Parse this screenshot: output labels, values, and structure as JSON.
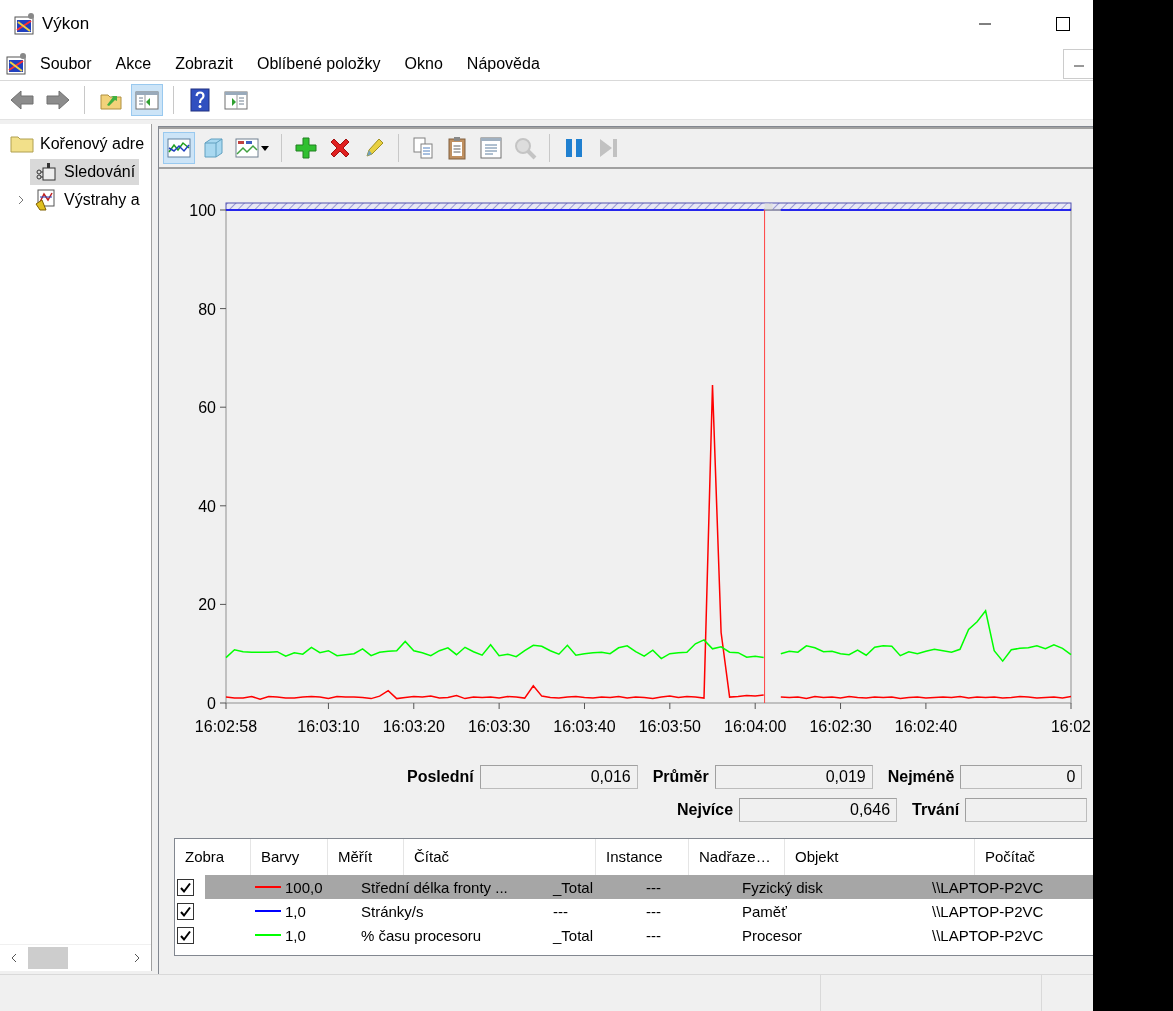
{
  "window": {
    "title": "Výkon"
  },
  "menu": [
    "Soubor",
    "Akce",
    "Zobrazit",
    "Oblíbené položky",
    "Okno",
    "Nápověda"
  ],
  "toolbar": [
    {
      "kind": "back",
      "pressed": false
    },
    {
      "kind": "forward",
      "pressed": false
    },
    {
      "kind": "separator"
    },
    {
      "kind": "up",
      "pressed": false
    },
    {
      "kind": "tree",
      "pressed": true
    },
    {
      "kind": "separator"
    },
    {
      "kind": "help",
      "pressed": false
    },
    {
      "kind": "pane",
      "pressed": false
    }
  ],
  "tree": [
    {
      "label": "Kořenový adre",
      "kind": "folder",
      "selected": false,
      "children": [
        {
          "label": "Sledování",
          "kind": "monitor",
          "selected": true
        },
        {
          "label": "Výstrahy a",
          "kind": "alerts",
          "selected": false,
          "expanded": false
        }
      ]
    }
  ],
  "chart_toolbar": [
    {
      "kind": "graph",
      "pressed": true,
      "disabled": false
    },
    {
      "kind": "histogram",
      "pressed": false,
      "disabled": false
    },
    {
      "kind": "report",
      "pressed": false,
      "disabled": false
    },
    {
      "kind": "separator"
    },
    {
      "kind": "add",
      "pressed": false,
      "disabled": false
    },
    {
      "kind": "delete",
      "pressed": false,
      "disabled": false
    },
    {
      "kind": "highlight",
      "pressed": false,
      "disabled": false
    },
    {
      "kind": "separator"
    },
    {
      "kind": "copy",
      "pressed": false,
      "disabled": false
    },
    {
      "kind": "paste",
      "pressed": false,
      "disabled": false
    },
    {
      "kind": "properties",
      "pressed": false,
      "disabled": false
    },
    {
      "kind": "zoom",
      "pressed": false,
      "disabled": true
    },
    {
      "kind": "separator"
    },
    {
      "kind": "pause",
      "pressed": false,
      "disabled": false
    },
    {
      "kind": "next",
      "pressed": false,
      "disabled": true
    }
  ],
  "chart": {
    "chart_data": {
      "type": "line",
      "categories": [
        "16:02:58",
        null,
        null,
        null,
        null,
        null,
        null,
        null,
        null,
        null,
        null,
        null,
        "16:03:10",
        null,
        null,
        null,
        null,
        null,
        null,
        null,
        null,
        null,
        "16:03:20",
        null,
        null,
        null,
        null,
        null,
        null,
        null,
        null,
        null,
        "16:03:30",
        null,
        null,
        null,
        null,
        null,
        null,
        null,
        null,
        null,
        "16:03:40",
        null,
        null,
        null,
        null,
        null,
        null,
        null,
        null,
        null,
        "16:03:50",
        null,
        null,
        null,
        null,
        null,
        null,
        null,
        null,
        null,
        "16:04:00",
        null,
        null,
        null,
        null,
        null,
        null,
        null,
        null,
        null,
        "16:02:30",
        null,
        null,
        null,
        null,
        null,
        null,
        null,
        null,
        null,
        "16:02:40",
        null,
        null,
        null,
        null,
        null,
        null,
        null,
        null,
        null,
        null,
        null,
        null,
        null,
        null,
        null,
        null,
        "16:02"
      ],
      "ylim": [
        0,
        100
      ],
      "yticks": [
        0,
        20,
        40,
        60,
        80,
        100
      ],
      "series": [
        {
          "color": "#ff0000",
          "values": [
            1.2,
            1.0,
            1.0,
            1.3,
            0.8,
            1.3,
            1.2,
            1.0,
            1.0,
            1.2,
            1.3,
            1.2,
            0.9,
            1.3,
            1.2,
            1.2,
            1.1,
            0.9,
            1.4,
            2.5,
            0.9,
            1.1,
            1.3,
            1.2,
            1.4,
            1.0,
            1.1,
            1.5,
            0.9,
            1.2,
            1.1,
            1.2,
            1.0,
            1.3,
            1.2,
            1.0,
            3.5,
            1.4,
            1.1,
            1.0,
            1.2,
            1.3,
            1.1,
            1.0,
            1.2,
            1.1,
            1.3,
            1.0,
            1.2,
            1.1,
            0.9,
            1.2,
            1.4,
            1.1,
            1.3,
            1.2,
            1.0,
            64.5,
            14.3,
            1.2,
            1.3,
            1.5,
            1.4,
            1.6,
            null,
            1.2,
            1.1,
            1.2,
            0.9,
            1.3,
            1.1,
            1.2,
            1.0,
            1.3,
            1.1,
            1.0,
            1.2,
            1.1,
            1.2,
            0.9,
            1.1,
            1.2,
            1.0,
            1.1,
            1.2,
            1.1,
            1.3,
            1.0,
            1.2,
            1.1,
            1.2,
            1.0,
            1.1,
            1.3,
            1.2,
            1.0,
            1.1,
            1.2,
            1.0,
            1.3
          ]
        },
        {
          "color": "#0000ff",
          "values": [
            100,
            100,
            100,
            100,
            100,
            100,
            100,
            100,
            100,
            100,
            100,
            100,
            100,
            100,
            100,
            100,
            100,
            100,
            100,
            100,
            100,
            100,
            100,
            100,
            100,
            100,
            100,
            100,
            100,
            100,
            100,
            100,
            100,
            100,
            100,
            100,
            100,
            100,
            100,
            100,
            100,
            100,
            100,
            100,
            100,
            100,
            100,
            100,
            100,
            100,
            100,
            100,
            100,
            100,
            100,
            100,
            100,
            100,
            100,
            100,
            100,
            100,
            100,
            100,
            null,
            100,
            100,
            100,
            100,
            100,
            100,
            100,
            100,
            100,
            100,
            100,
            100,
            100,
            100,
            100,
            100,
            100,
            100,
            100,
            100,
            100,
            100,
            100,
            100,
            100,
            100,
            100,
            100,
            100,
            100,
            100,
            100,
            100,
            100,
            100
          ]
        },
        {
          "color": "#00ff00",
          "values": [
            9.2,
            10.8,
            10.4,
            10.3,
            10.3,
            10.3,
            10.4,
            9.5,
            10.2,
            9.9,
            11.3,
            10.2,
            10.6,
            9.6,
            9.8,
            10.0,
            11.0,
            9.6,
            10.3,
            10.5,
            10.6,
            12.5,
            10.6,
            10.2,
            9.6,
            10.6,
            11.2,
            9.8,
            11.3,
            10.4,
            9.7,
            11.8,
            9.6,
            9.9,
            9.4,
            10.6,
            11.7,
            11.5,
            10.6,
            9.9,
            11.7,
            9.7,
            10.0,
            10.2,
            10.3,
            10.0,
            11.2,
            11.6,
            10.4,
            9.5,
            10.7,
            9.0,
            10.0,
            10.2,
            10.3,
            12.0,
            12.8,
            11.0,
            11.4,
            10.3,
            10.2,
            9.3,
            9.5,
            9.2,
            null,
            10.0,
            10.5,
            10.3,
            11.6,
            11.2,
            10.4,
            10.5,
            10.0,
            9.8,
            10.7,
            9.7,
            11.3,
            11.6,
            11.5,
            9.6,
            10.4,
            10.0,
            10.5,
            10.9,
            10.6,
            10.3,
            10.9,
            14.9,
            16.5,
            18.7,
            10.6,
            8.5,
            10.8,
            11.1,
            11.2,
            11.6,
            11.0,
            11.8,
            11.1,
            9.8
          ]
        }
      ]
    }
  },
  "statistics": [
    [
      {
        "label": "Poslední",
        "value": "0,016"
      },
      {
        "label": "Průměr",
        "value": "0,019"
      },
      {
        "label": "Nejméně",
        "value": "0"
      }
    ],
    [
      {
        "label": "Nejvíce",
        "value": "0,646"
      },
      {
        "label": "Trvání"
      }
    ]
  ],
  "counters": {
    "columns": [
      "Zobra",
      "Barvy",
      "Měřít",
      "Čítač",
      "Instance",
      "Nadřaze…",
      "Objekt",
      "Počítač"
    ],
    "rows": [
      {
        "checked": true,
        "color": "#ff0000",
        "scale": "100,0",
        "counter": "Střední délka fronty ...",
        "instance": "_Total",
        "parent": "---",
        "object": "Fyzický disk",
        "computer": "\\\\LAPTOP-P2VC",
        "selected": true
      },
      {
        "checked": true,
        "color": "#0000ff",
        "scale": "1,0",
        "counter": "Stránky/s",
        "instance": "---",
        "parent": "---",
        "object": "Paměť",
        "computer": "\\\\LAPTOP-P2VC",
        "selected": false
      },
      {
        "checked": true,
        "color": "#00ff00",
        "scale": "1,0",
        "counter": "% času procesoru",
        "instance": "_Total",
        "parent": "---",
        "object": "Procesor",
        "computer": "\\\\LAPTOP-P2VC",
        "selected": false
      }
    ]
  }
}
